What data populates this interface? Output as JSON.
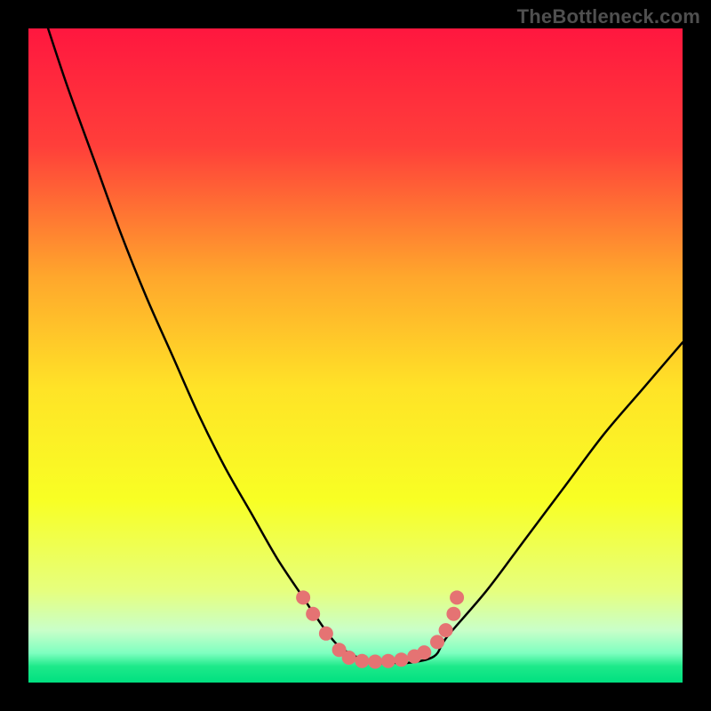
{
  "watermark": "TheBottleneck.com",
  "chart_data": {
    "type": "line",
    "title": "",
    "xlabel": "",
    "ylabel": "",
    "xlim": [
      0,
      100
    ],
    "ylim": [
      0,
      100
    ],
    "grid": false,
    "legend": false,
    "gradient_stops": [
      {
        "offset": 0.0,
        "color": "#ff173f"
      },
      {
        "offset": 0.18,
        "color": "#ff3f3a"
      },
      {
        "offset": 0.38,
        "color": "#ffa72c"
      },
      {
        "offset": 0.55,
        "color": "#ffe327"
      },
      {
        "offset": 0.72,
        "color": "#f8ff24"
      },
      {
        "offset": 0.86,
        "color": "#e6ff7e"
      },
      {
        "offset": 0.92,
        "color": "#c9ffc9"
      },
      {
        "offset": 0.955,
        "color": "#7effc0"
      },
      {
        "offset": 0.975,
        "color": "#1ee98a"
      },
      {
        "offset": 1.0,
        "color": "#00e080"
      }
    ],
    "series": [
      {
        "name": "bottleneck-curve",
        "color": "#000000",
        "x": [
          3,
          6,
          10,
          14,
          18,
          22,
          26,
          30,
          34,
          38,
          42,
          44,
          47,
          50,
          53,
          56,
          58,
          62,
          64,
          70,
          76,
          82,
          88,
          94,
          100
        ],
        "y": [
          100,
          91,
          80,
          69,
          59,
          50,
          41,
          33,
          26,
          19,
          13,
          10,
          6,
          4,
          3,
          3,
          3,
          4,
          7,
          14,
          22,
          30,
          38,
          45,
          52
        ]
      }
    ],
    "markers": {
      "name": "highlight-dots",
      "color": "#e57373",
      "points": [
        {
          "x": 42.0,
          "y": 13.0
        },
        {
          "x": 43.5,
          "y": 10.5
        },
        {
          "x": 45.5,
          "y": 7.5
        },
        {
          "x": 47.5,
          "y": 5.0
        },
        {
          "x": 49.0,
          "y": 3.8
        },
        {
          "x": 51.0,
          "y": 3.3
        },
        {
          "x": 53.0,
          "y": 3.2
        },
        {
          "x": 55.0,
          "y": 3.3
        },
        {
          "x": 57.0,
          "y": 3.5
        },
        {
          "x": 59.0,
          "y": 4.0
        },
        {
          "x": 60.5,
          "y": 4.6
        },
        {
          "x": 62.5,
          "y": 6.2
        },
        {
          "x": 63.8,
          "y": 8.0
        },
        {
          "x": 65.0,
          "y": 10.5
        },
        {
          "x": 65.5,
          "y": 13.0
        }
      ]
    }
  }
}
